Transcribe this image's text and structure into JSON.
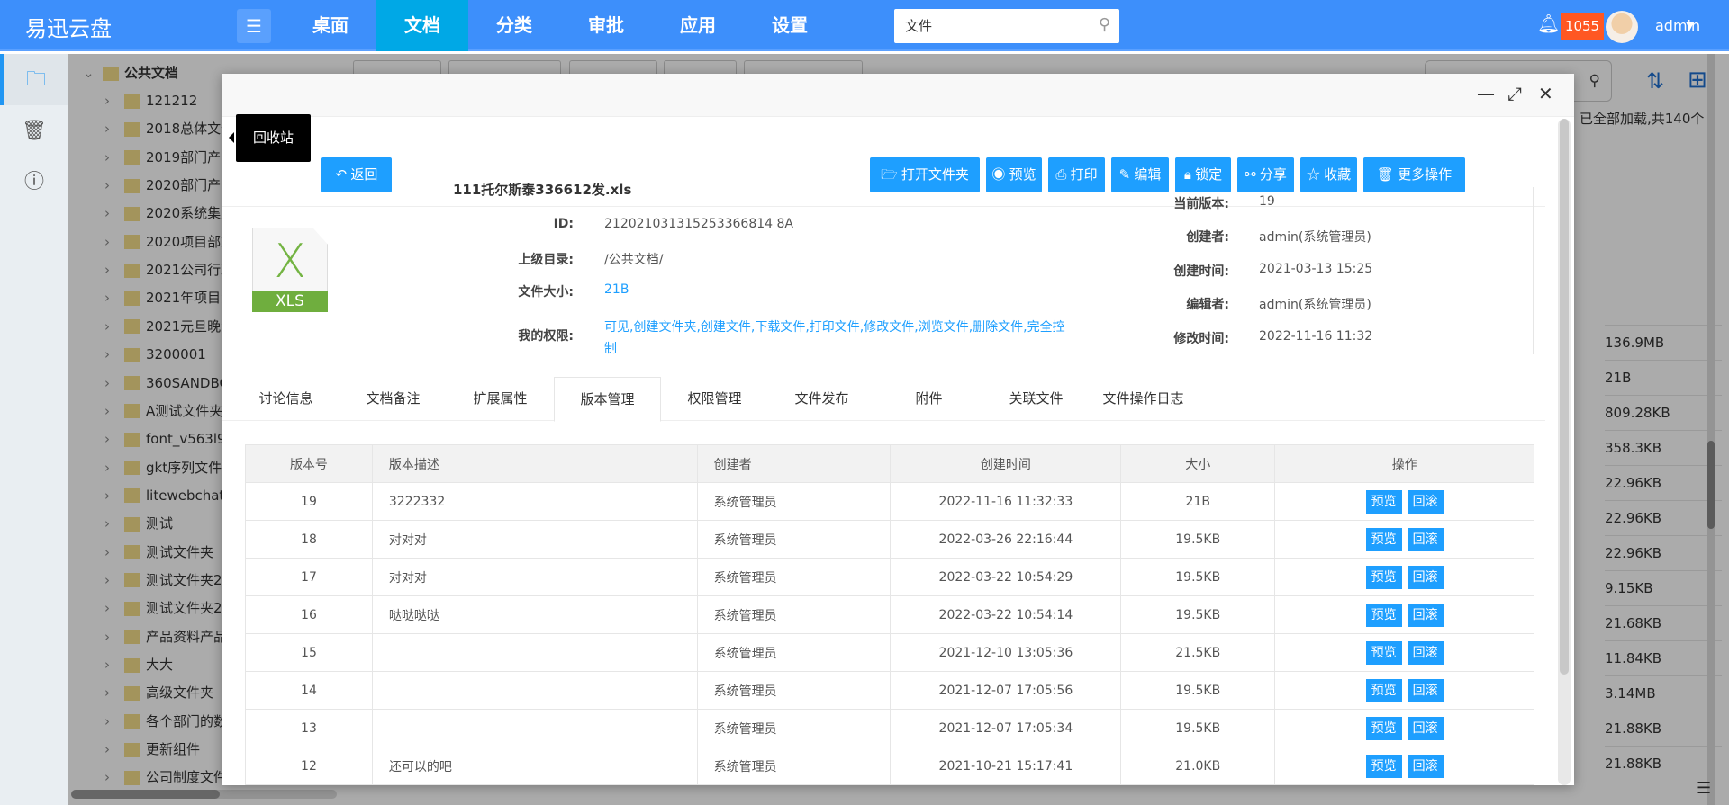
{
  "app": {
    "title": "易迅云盘",
    "nav": [
      "桌面",
      "文档",
      "分类",
      "审批",
      "应用",
      "设置"
    ],
    "active_nav": "文档",
    "search_value": "文件",
    "notifications": "1055",
    "user": "admin",
    "accent": "#3d8ffb",
    "active_nav_color": "#00a8e6",
    "badge_color": "#ff5722"
  },
  "iconbar": {
    "items": [
      {
        "icon": "folder-icon",
        "active": true
      },
      {
        "icon": "trash-icon"
      },
      {
        "icon": "info-icon"
      }
    ]
  },
  "tree": {
    "root": "公共文档",
    "items": [
      "121212",
      "2018总体文件",
      "2019部门产品",
      "2020部门产品",
      "2020系统集成",
      "2020项目部文",
      "2021公司行政",
      "2021年项目资",
      "2021元旦晚会",
      "3200001",
      "360SANDBOX",
      "A测试文件夹",
      "font_v563l96",
      "gkt序列文件",
      "litewebchat_",
      "测试",
      "测试文件夹",
      "测试文件夹20",
      "测试文件夹20",
      "产品资料产品",
      "大大",
      "高级文件夹",
      "各个部门的数",
      "更新组件",
      "公司制度文件"
    ]
  },
  "background_list": {
    "loaded_text": "已全部加载,共140个",
    "sizes": [
      "136.9MB",
      "21B",
      "809.28KB",
      "358.3KB",
      "22.96KB",
      "22.96KB",
      "22.96KB",
      "9.15KB",
      "21.68KB",
      "11.84KB",
      "3.14MB",
      "21.88KB",
      "21.88KB"
    ]
  },
  "tooltip": "回收站",
  "modal": {
    "back": "返回",
    "actions": [
      "打开文件夹",
      "预览",
      "打印",
      "编辑",
      "锁定",
      "分享",
      "收藏",
      "更多操作"
    ],
    "file": {
      "name": "111托尔斯泰336612发.xls",
      "type_label": "XLS",
      "left": [
        {
          "label": "ID:",
          "value": "212021031315253366814 8A"
        },
        {
          "label": "上级目录:",
          "value": "/公共文档/"
        },
        {
          "label": "文件大小:",
          "value": "21B"
        },
        {
          "label": "我的权限:",
          "value": "可见,创建文件夹,创建文件,下载文件,打印文件,修改文件,浏览文件,删除文件,完全控制"
        }
      ],
      "right": [
        {
          "label": "当前版本:",
          "value": "19"
        },
        {
          "label": "创建者:",
          "value": "admin(系统管理员)"
        },
        {
          "label": "创建时间:",
          "value": "2021-03-13 15:25"
        },
        {
          "label": "编辑者:",
          "value": "admin(系统管理员)"
        },
        {
          "label": "修改时间:",
          "value": "2022-11-16 11:32"
        }
      ]
    },
    "tabs": [
      "讨论信息",
      "文档备注",
      "扩展属性",
      "版本管理",
      "权限管理",
      "文件发布",
      "附件",
      "关联文件",
      "文件操作日志"
    ],
    "active_tab": "版本管理",
    "table": {
      "headers": [
        "版本号",
        "版本描述",
        "创建者",
        "创建时间",
        "大小",
        "操作"
      ],
      "rows": [
        [
          "19",
          "3222332",
          "系统管理员",
          "2022-11-16 11:32:33",
          "21B"
        ],
        [
          "18",
          "对对对",
          "系统管理员",
          "2022-03-26 22:16:44",
          "19.5KB"
        ],
        [
          "17",
          "对对对",
          "系统管理员",
          "2022-03-22 10:54:29",
          "19.5KB"
        ],
        [
          "16",
          "哒哒哒哒",
          "系统管理员",
          "2022-03-22 10:54:14",
          "19.5KB"
        ],
        [
          "15",
          "",
          "系统管理员",
          "2021-12-10 13:05:36",
          "21.5KB"
        ],
        [
          "14",
          "",
          "系统管理员",
          "2021-12-07 17:05:56",
          "19.5KB"
        ],
        [
          "13",
          "",
          "系统管理员",
          "2021-12-07 17:05:34",
          "19.5KB"
        ],
        [
          "12",
          "还可以的吧",
          "系统管理员",
          "2021-10-21 15:17:41",
          "21.0KB"
        ]
      ],
      "row_actions": [
        "预览",
        "回滚"
      ]
    }
  }
}
